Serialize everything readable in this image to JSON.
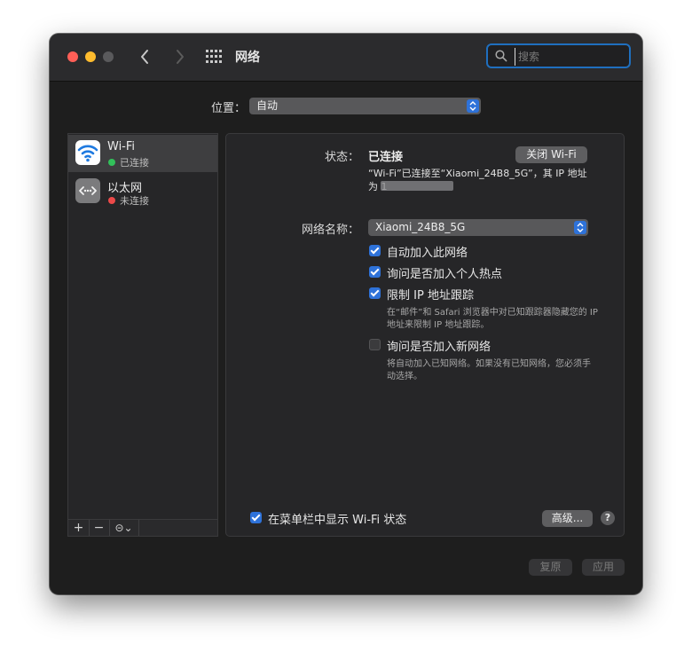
{
  "window": {
    "title": "网络"
  },
  "search": {
    "placeholder": "搜索"
  },
  "location": {
    "label": "位置：",
    "value": "自动"
  },
  "services": [
    {
      "name": "Wi-Fi",
      "status": "已连接",
      "status_color": "#32c05a"
    },
    {
      "name": "以太网",
      "status": "未连接",
      "status_color": "#ec4949"
    }
  ],
  "sidebar_tools": {
    "add": "+",
    "remove": "−",
    "action": "⊝⌄"
  },
  "detail": {
    "status_label": "状态：",
    "status_value": "已连接",
    "toggle_button": "关闭 Wi-Fi",
    "status_desc_line1": "“Wi-Fi”已连接至“Xiaomi_24B8_5G”，其 IP 地址",
    "status_desc_line2": "为 1",
    "network_label": "网络名称：",
    "network_value": "Xiaomi_24B8_5G",
    "options": [
      {
        "label": "自动加入此网络",
        "checked": true
      },
      {
        "label": "询问是否加入个人热点",
        "checked": true
      },
      {
        "label": "限制 IP 地址跟踪",
        "checked": true,
        "desc_line1": "在“邮件”和 Safari 浏览器中对已知跟踪器隐藏您的 IP",
        "desc_line2": "地址来限制 IP 地址跟踪。"
      },
      {
        "label": "询问是否加入新网络",
        "checked": false,
        "desc_line1": "将自动加入已知网络。如果没有已知网络，您必须手",
        "desc_line2": "动选择。"
      }
    ],
    "menubar_label": "在菜单栏中显示 Wi-Fi 状态",
    "menubar_checked": true,
    "advanced_button": "高级...",
    "help": "?"
  },
  "footer": {
    "revert": "复原",
    "apply": "应用"
  },
  "colors": {
    "accent": "#2e72d9",
    "focus_ring": "#1f6fbf"
  }
}
